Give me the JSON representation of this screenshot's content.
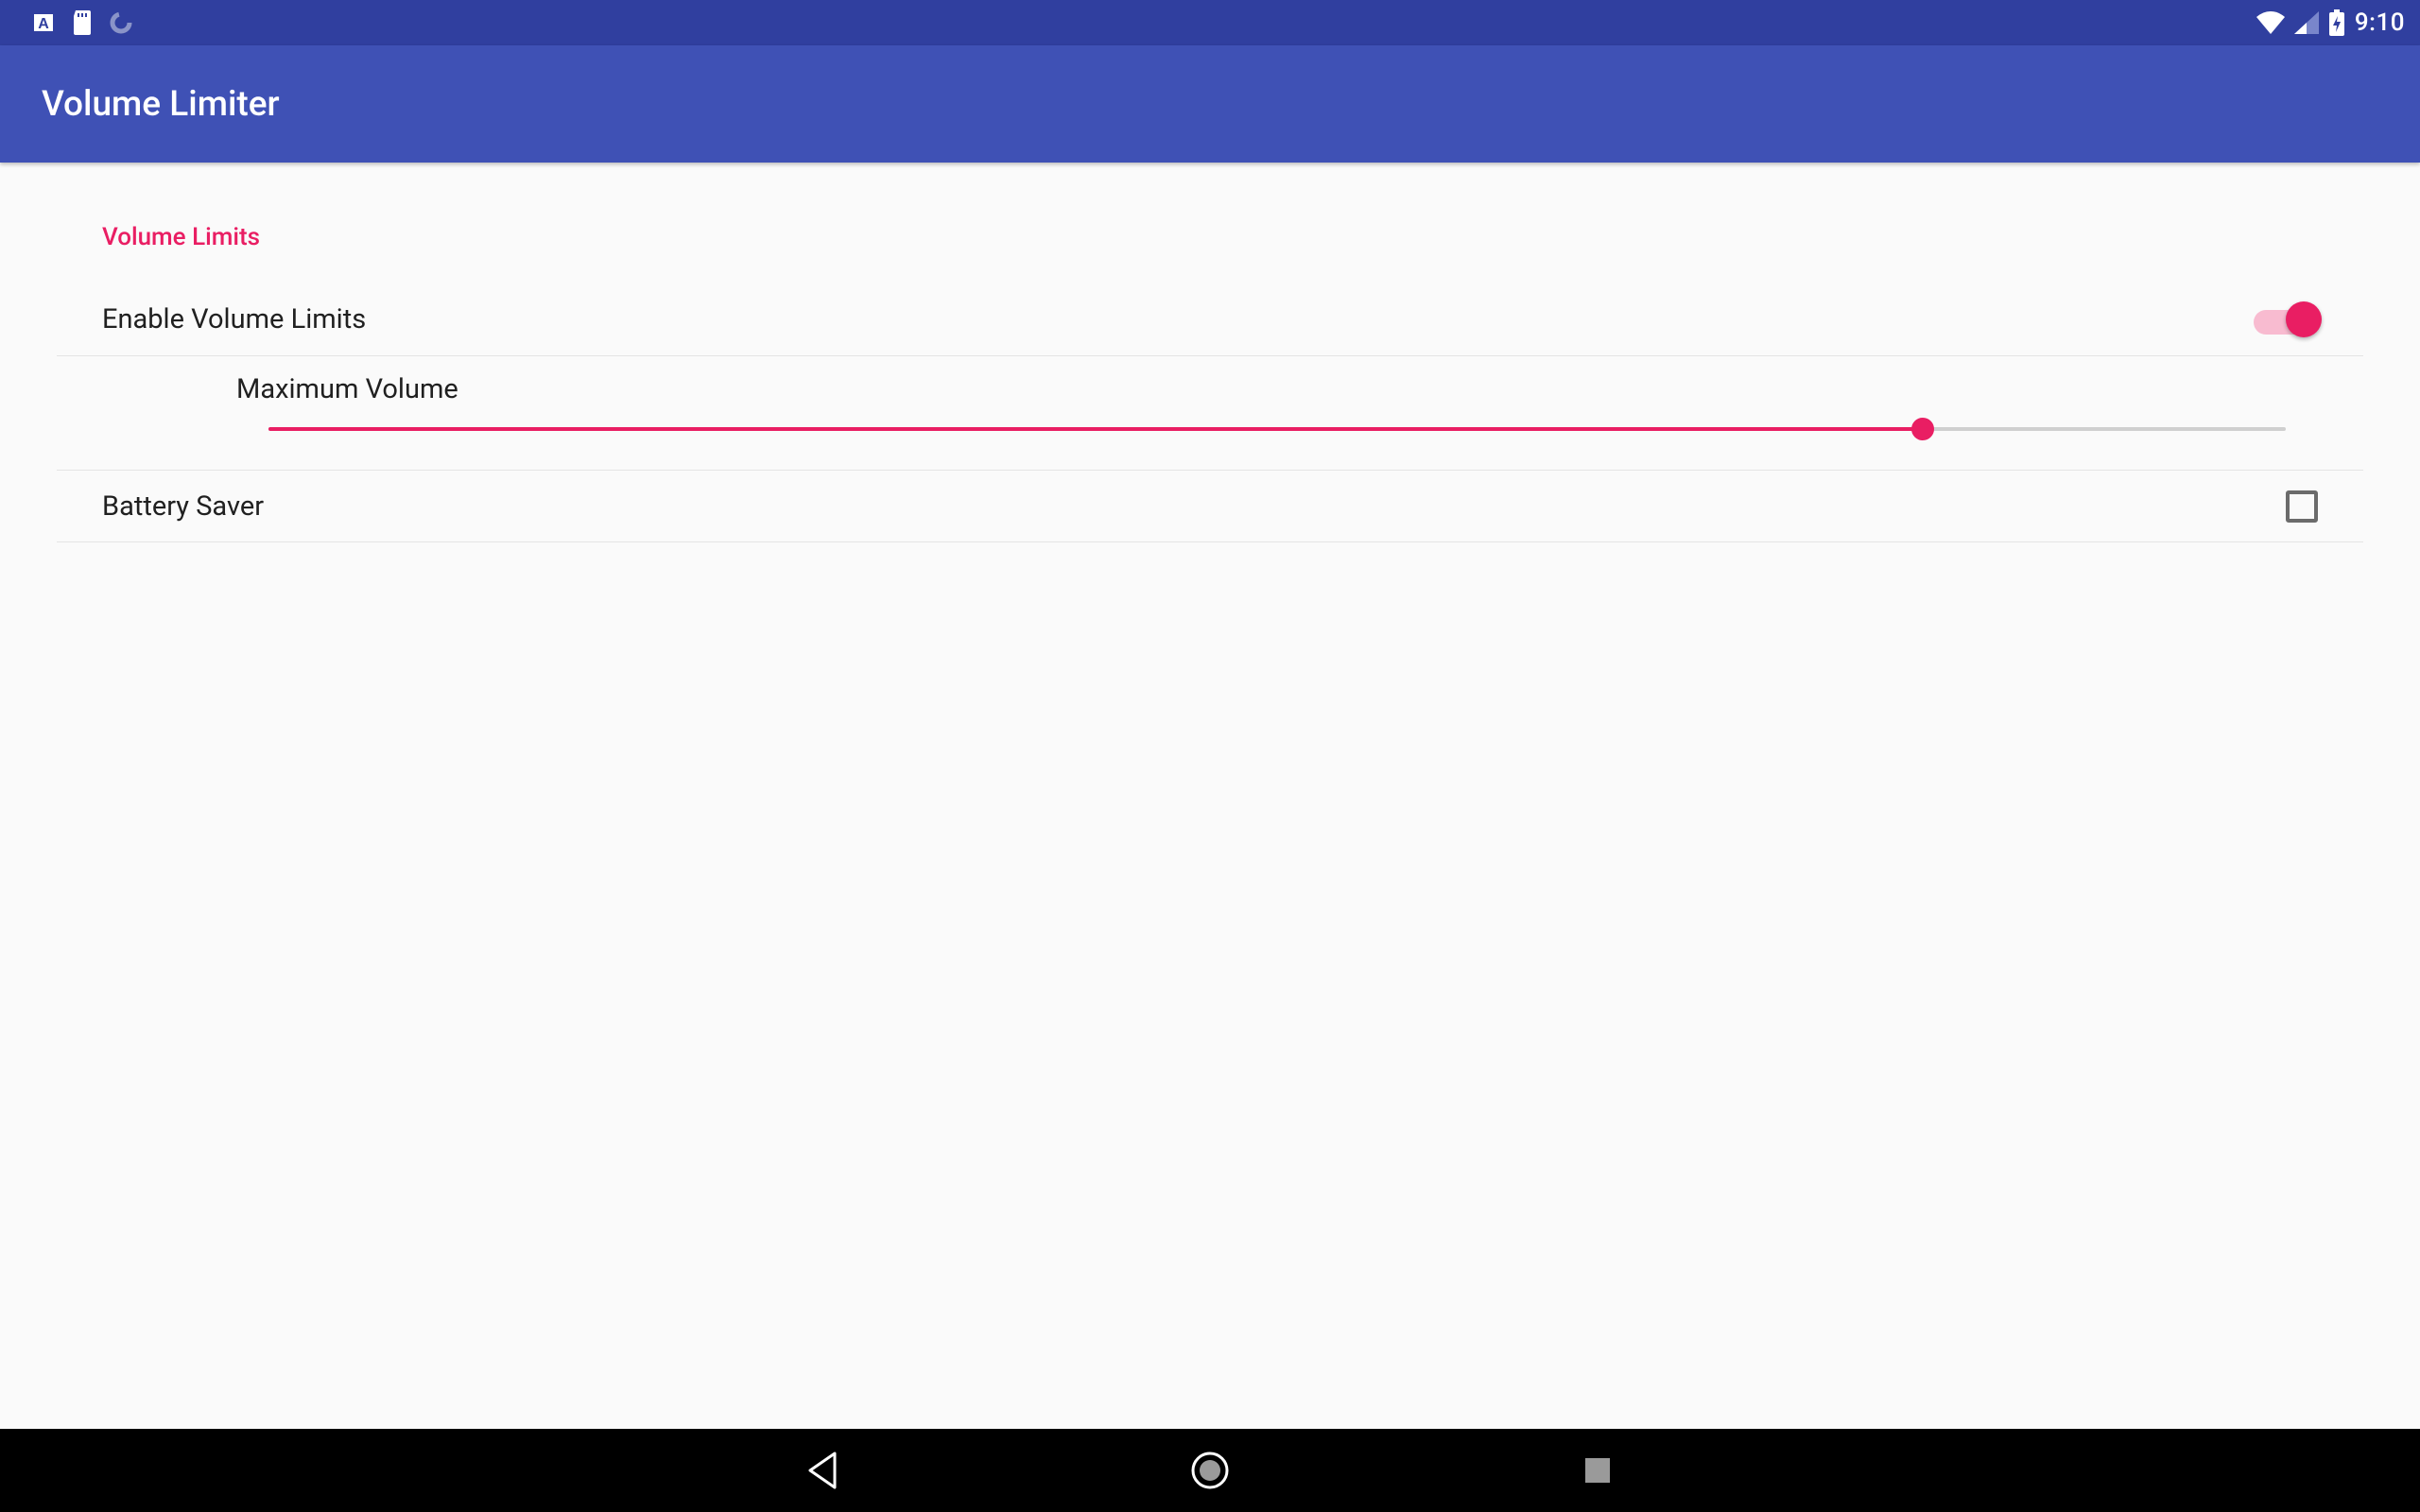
{
  "status": {
    "time": "9:10"
  },
  "app": {
    "title": "Volume Limiter"
  },
  "settings": {
    "section_title": "Volume Limits",
    "enable_label": "Enable Volume Limits",
    "enable_on": true,
    "max_label": "Maximum Volume",
    "max_percent": 82,
    "battery_label": "Battery Saver",
    "battery_checked": false
  },
  "colors": {
    "primary": "#3f51b5",
    "primary_dark": "#303f9f",
    "accent": "#e91e63"
  }
}
